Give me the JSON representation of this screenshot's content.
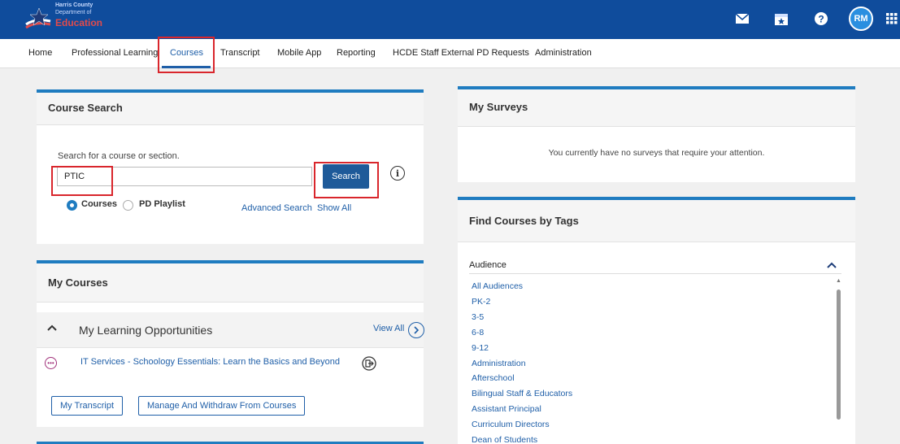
{
  "header": {
    "logo": {
      "line1": "Harris County",
      "line2": "Department of",
      "line3": "Education"
    },
    "avatar_initials": "RM"
  },
  "nav": {
    "items": [
      "Home",
      "Professional Learning",
      "Courses",
      "Transcript",
      "Mobile App",
      "Reporting",
      "HCDE Staff External PD Requests",
      "Administration"
    ],
    "active": "Courses"
  },
  "course_search": {
    "title": "Course Search",
    "label": "Search for a course or section.",
    "input_value": "PTIC",
    "search_button": "Search",
    "radio_courses": "Courses",
    "radio_playlist": "PD Playlist",
    "advanced_search": "Advanced Search",
    "show_all": "Show All"
  },
  "my_courses": {
    "title": "My Courses",
    "section_title": "My Learning Opportunities",
    "view_all": "View All",
    "course_item": "IT Services - Schoology Essentials: Learn the Basics and Beyond",
    "my_transcript_btn": "My Transcript",
    "manage_btn": "Manage And Withdraw From Courses"
  },
  "my_surveys": {
    "title": "My Surveys",
    "message": "You currently have no surveys that require your attention."
  },
  "find_tags": {
    "title": "Find Courses by Tags",
    "audience_label": "Audience",
    "tags": [
      "All Audiences",
      "PK-2",
      "3-5",
      "6-8",
      "9-12",
      "Administration",
      "Afterschool",
      "Bilingual Staff & Educators",
      "Assistant Principal",
      "Curriculum Directors",
      "Dean of Students"
    ]
  },
  "colors": {
    "header": "#0f4c9c",
    "accent": "#1f7cc0",
    "highlight": "#d9262c"
  }
}
